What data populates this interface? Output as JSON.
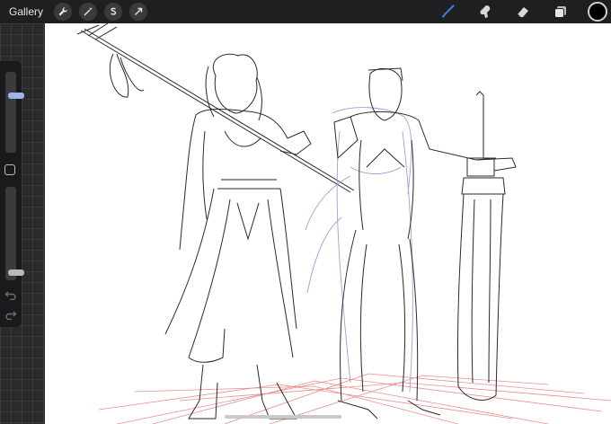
{
  "topbar": {
    "gallery_label": "Gallery",
    "left_tools": [
      {
        "name": "wrench-icon"
      },
      {
        "name": "magic-wand-icon"
      },
      {
        "name": "selection-s-icon"
      },
      {
        "name": "transform-arrow-icon"
      }
    ],
    "right_tools": [
      {
        "name": "brush-icon"
      },
      {
        "name": "smudge-icon"
      },
      {
        "name": "eraser-icon"
      },
      {
        "name": "layers-icon"
      }
    ],
    "current_color": "#000000",
    "active_tool_color": "#3a7bd5"
  },
  "sidebar": {
    "brush_size_level": 0.72,
    "opacity_level": 0.05,
    "accent": "#9fb4e6"
  },
  "canvas": {
    "background": "#ffffff",
    "sketch_stroke": "#2a2a2a",
    "guide_stroke": "#9aa0d8",
    "perspective_stroke": "#e06a6a"
  }
}
